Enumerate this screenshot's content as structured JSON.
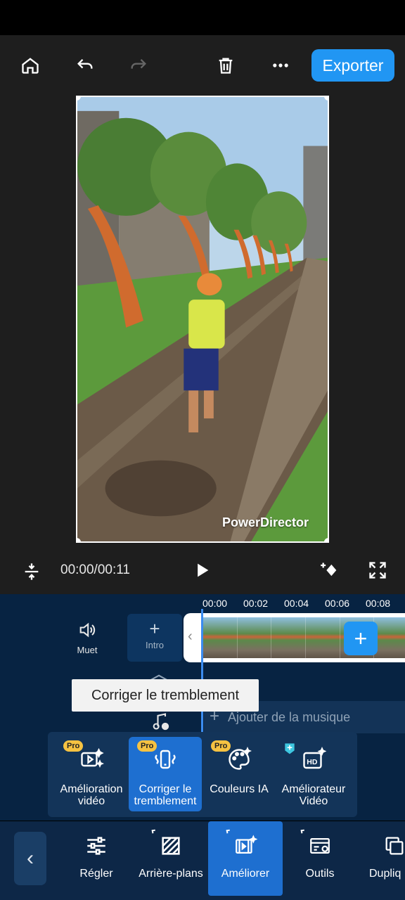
{
  "toolbar": {
    "export_label": "Exporter"
  },
  "preview": {
    "watermark": "PowerDirector"
  },
  "playback": {
    "time": "00:00/00:11"
  },
  "timeline": {
    "ruler": [
      "00:00",
      "00:02",
      "00:04",
      "00:06",
      "00:08"
    ],
    "mute_label": "Muet",
    "intro_label": "Intro",
    "add_music_label": "Ajouter de la musique",
    "tooltip": "Corriger le tremblement"
  },
  "features": [
    {
      "label": "Amélioration vidéo",
      "pro": "Pro",
      "icon": "video-sparkle-icon"
    },
    {
      "label": "Corriger le tremblement",
      "pro": "Pro",
      "icon": "stabilize-icon"
    },
    {
      "label": "Couleurs IA",
      "pro": "Pro",
      "icon": "palette-icon"
    },
    {
      "label": "Améliorateur Vidéo",
      "icon": "hd-enhance-icon"
    }
  ],
  "nav": [
    {
      "label": "Régler",
      "icon": "sliders-icon"
    },
    {
      "label": "Arrière-plans",
      "icon": "hatched-square-icon"
    },
    {
      "label": "Améliorer",
      "icon": "film-sparkle-icon"
    },
    {
      "label": "Outils",
      "icon": "tools-icon"
    },
    {
      "label": "Dupliq",
      "icon": "duplicate-icon"
    }
  ],
  "colors": {
    "accent": "#2196f3",
    "active": "#1e6fd0",
    "timeline_bg": "#072342",
    "pro_badge": "#f5c242"
  }
}
